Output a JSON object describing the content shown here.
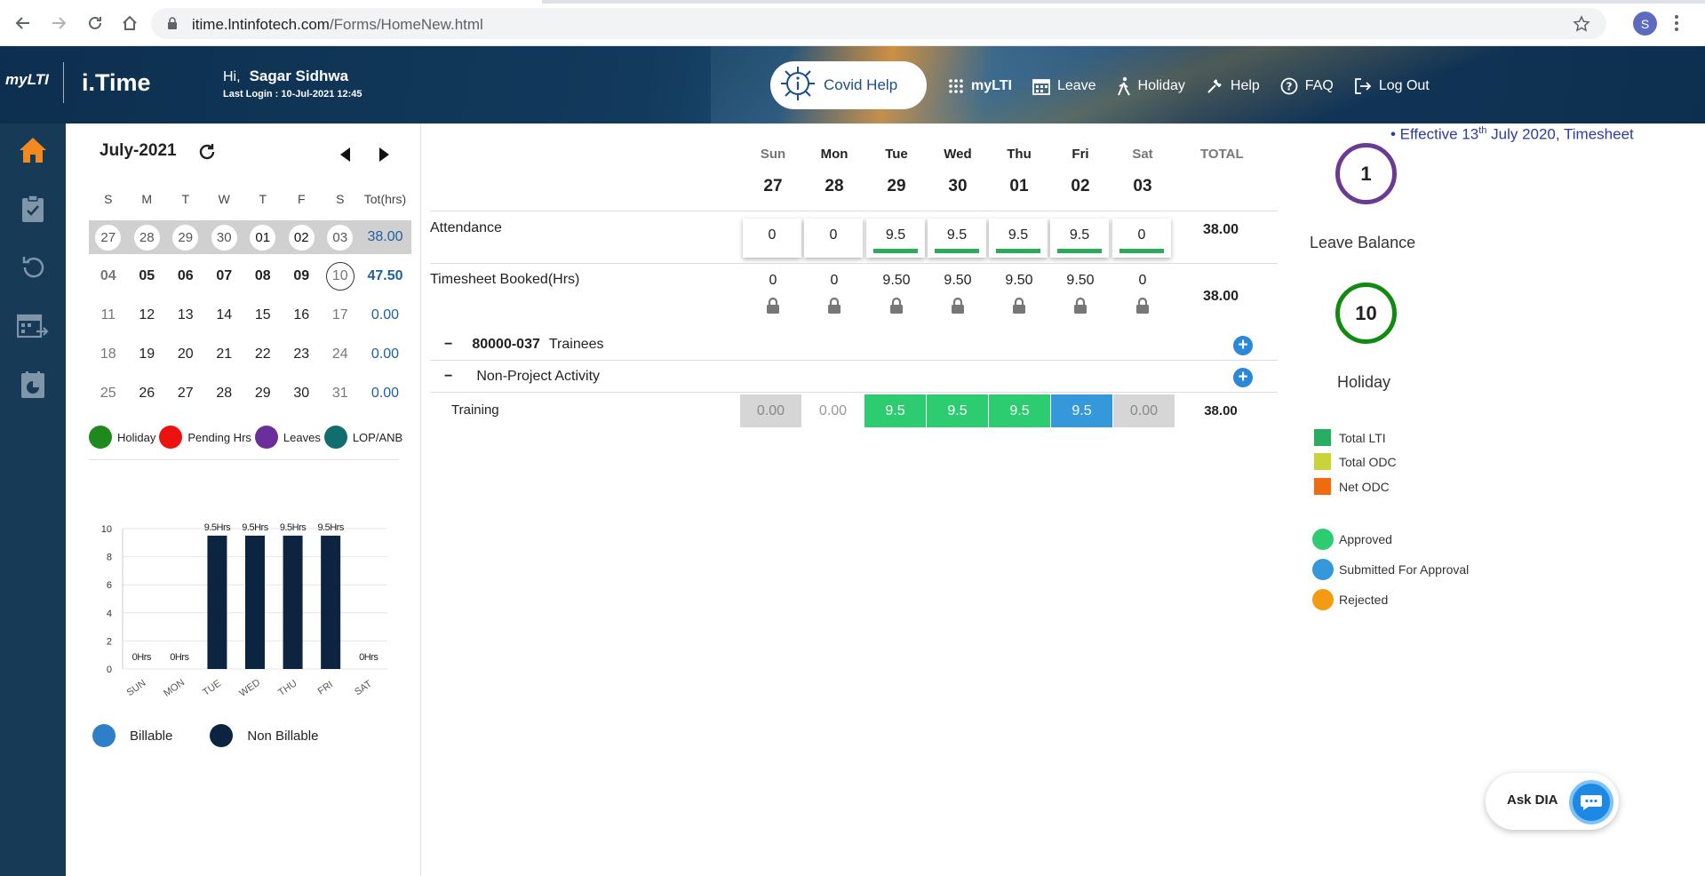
{
  "browser": {
    "url_host": "itime.lntinfotech.com",
    "url_path": "/Forms/HomeNew.html",
    "profile_initial": "S"
  },
  "header": {
    "logo": "myLTI",
    "app_title": "i.Time",
    "greeting": "Hi,",
    "user_name": "Sagar Sidhwa",
    "last_login": "Last Login :  10-Jul-2021 12:45",
    "covid_label": "Covid Help",
    "nav": [
      {
        "label": "myLTI",
        "icon": "apps-grid-icon"
      },
      {
        "label": "Leave",
        "icon": "calendar-icon"
      },
      {
        "label": "Holiday",
        "icon": "walking-person-icon"
      },
      {
        "label": "Help",
        "icon": "wrench-icon"
      },
      {
        "label": "FAQ",
        "icon": "question-circle-icon"
      },
      {
        "label": "Log Out",
        "icon": "logout-icon"
      }
    ]
  },
  "sidebar": {
    "items": [
      "home-icon",
      "clipboard-check-icon",
      "undo-icon",
      "calendar-forward-icon",
      "calendar-pie-icon"
    ],
    "active": 0
  },
  "calendar": {
    "month": "July-2021",
    "weekday_headers": [
      "S",
      "M",
      "T",
      "W",
      "T",
      "F",
      "S"
    ],
    "total_header": "Tot(hrs)",
    "rows": [
      {
        "days": [
          "27",
          "28",
          "29",
          "30",
          "01",
          "02",
          "03"
        ],
        "total": "38.00"
      },
      {
        "days": [
          "04",
          "05",
          "06",
          "07",
          "08",
          "09",
          "10"
        ],
        "total": "47.50"
      },
      {
        "days": [
          "11",
          "12",
          "13",
          "14",
          "15",
          "16",
          "17"
        ],
        "total": "0.00"
      },
      {
        "days": [
          "18",
          "19",
          "20",
          "21",
          "22",
          "23",
          "24"
        ],
        "total": "0.00"
      },
      {
        "days": [
          "25",
          "26",
          "27",
          "28",
          "29",
          "30",
          "31"
        ],
        "total": "0.00"
      }
    ],
    "legend": [
      {
        "label": "Holiday",
        "color": "#1e8a1e"
      },
      {
        "label": "Pending Hrs",
        "color": "#ee1111"
      },
      {
        "label": "Leaves",
        "color": "#6a2f9a"
      },
      {
        "label": "LOP/ANB",
        "color": "#126e6e"
      }
    ]
  },
  "chart_data": {
    "type": "bar",
    "categories": [
      "SUN",
      "MON",
      "TUE",
      "WED",
      "THU",
      "FRI",
      "SAT"
    ],
    "values": [
      0,
      0,
      9.5,
      9.5,
      9.5,
      9.5,
      0
    ],
    "data_labels": [
      "0Hrs",
      "0Hrs",
      "9.5Hrs",
      "9.5Hrs",
      "9.5Hrs",
      "9.5Hrs",
      "0Hrs"
    ],
    "ylim": [
      0,
      10
    ],
    "yticks": [
      "0",
      "2",
      "4",
      "6",
      "8",
      "10"
    ],
    "bar_color": "#0c2440",
    "grid": true
  },
  "billing_legend": [
    {
      "label": "Billable",
      "color": "#2f7fc8"
    },
    {
      "label": "Non Billable",
      "color": "#0c2440"
    }
  ],
  "timesheet": {
    "days": [
      {
        "name": "Sun",
        "num": "27"
      },
      {
        "name": "Mon",
        "num": "28"
      },
      {
        "name": "Tue",
        "num": "29"
      },
      {
        "name": "Wed",
        "num": "30"
      },
      {
        "name": "Thu",
        "num": "01"
      },
      {
        "name": "Fri",
        "num": "02"
      },
      {
        "name": "Sat",
        "num": "03"
      }
    ],
    "total_header": "TOTAL",
    "attendance_label": "Attendance",
    "attendance": [
      "0",
      "0",
      "9.5",
      "9.5",
      "9.5",
      "9.5",
      "0"
    ],
    "attendance_total": "38.00",
    "booked_label": "Timesheet Booked(Hrs)",
    "booked": [
      "0",
      "0",
      "9.50",
      "9.50",
      "9.50",
      "9.50",
      "0"
    ],
    "booked_total": "38.00",
    "project_code": "80000-037",
    "project_name": "Trainees",
    "non_project": "Non-Project Activity",
    "collapse_symbol": "−",
    "add_symbol": "+",
    "training_label": "Training",
    "training": [
      "0.00",
      "0.00",
      "9.5",
      "9.5",
      "9.5",
      "9.5",
      "0.00"
    ],
    "training_total": "38.00"
  },
  "right_panel": {
    "ticker": "• Effective 13th July 2020, Timesheet",
    "leave_balance_value": "1",
    "leave_balance_label": "Leave Balance",
    "holiday_value": "10",
    "holiday_label": "Holiday",
    "odc_legend": [
      {
        "label": "Total LTI",
        "color": "#27ae60"
      },
      {
        "label": "Total ODC",
        "color": "#c8d43a"
      },
      {
        "label": "Net ODC",
        "color": "#f06b0e"
      }
    ],
    "status_legend": [
      {
        "label": "Approved",
        "color": "#2ecc71"
      },
      {
        "label": "Submitted For Approval",
        "color": "#3498db"
      },
      {
        "label": "Rejected",
        "color": "#f39c12"
      }
    ]
  },
  "ask_dia": "Ask DIA"
}
